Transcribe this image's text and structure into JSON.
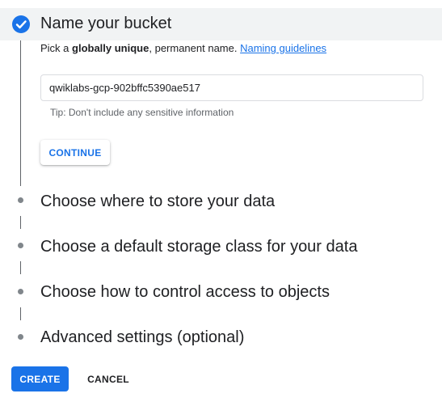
{
  "steps": {
    "name_bucket": {
      "title": "Name your bucket",
      "description": {
        "prefix": "Pick a ",
        "bold": "globally unique",
        "suffix": ", permanent name. ",
        "link": "Naming guidelines"
      },
      "input_value": "qwiklabs-gcp-902bffc5390ae517",
      "hint": "Tip: Don't include any sensitive information",
      "continue_label": "CONTINUE",
      "completed_icon": "check-circle-icon"
    },
    "location": {
      "title": "Choose where to store your data"
    },
    "storage_class": {
      "title": "Choose a default storage class for your data"
    },
    "access_control": {
      "title": "Choose how to control access to objects"
    },
    "advanced": {
      "title": "Advanced settings (optional)"
    }
  },
  "actions": {
    "create_label": "CREATE",
    "cancel_label": "CANCEL"
  },
  "colors": {
    "accent": "#1a73e8",
    "active_step_bg": "#f1f3f4",
    "text": "#202124",
    "muted": "#5f6368"
  }
}
